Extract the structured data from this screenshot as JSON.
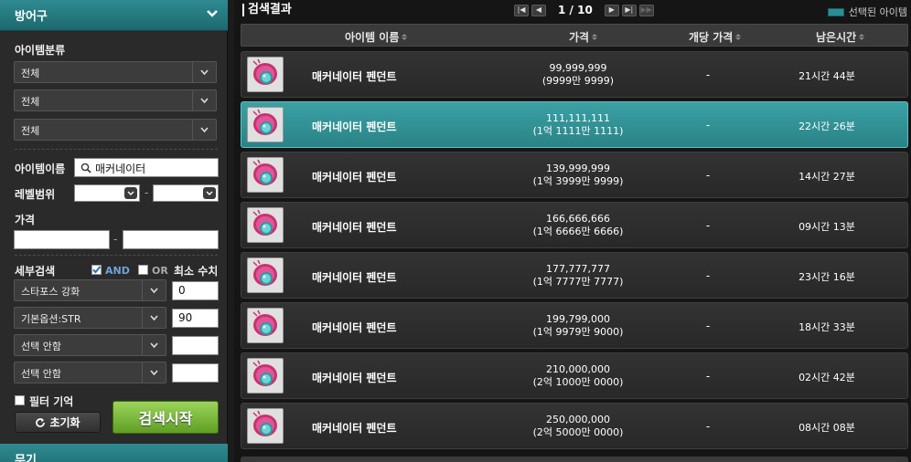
{
  "sidebar": {
    "category_title": "방어구",
    "next_category_title": "무기",
    "item_class_label": "아이템분류",
    "class_selects": [
      "전체",
      "전체",
      "전체"
    ],
    "item_name_label": "아이템이름",
    "item_name_value": "매커네이터",
    "level_range_label": "레벨범위",
    "level_dash": "-",
    "price_label": "가격",
    "price_dash": "-",
    "detail_label": "세부검색",
    "and_label": "AND",
    "or_label": "OR",
    "min_label": "최소 수치",
    "options": [
      {
        "name": "스타포스 강화",
        "value": "0"
      },
      {
        "name": "기본옵션:STR",
        "value": "90"
      },
      {
        "name": "선택 안함",
        "value": ""
      },
      {
        "name": "선택 안함",
        "value": ""
      }
    ],
    "filter_memory_label": "필터 기억",
    "reset_label": "초기화",
    "search_label": "검색시작"
  },
  "main": {
    "title": "검색결과",
    "page_info": "1 / 10",
    "legend_label": "선택된 아이템",
    "selected_color": "#2a8e92",
    "columns": [
      "아이템 이름",
      "가격",
      "개당 가격",
      "남은시간"
    ],
    "rows": [
      {
        "name": "매커네이터 펜던트",
        "price": "99,999,999",
        "price_kr": "(9999만 9999)",
        "unit": "-",
        "time": "21시간 44분"
      },
      {
        "name": "매커네이터 펜던트",
        "price": "111,111,111",
        "price_kr": "(1억 1111만 1111)",
        "unit": "-",
        "time": "22시간 26분"
      },
      {
        "name": "매커네이터 펜던트",
        "price": "139,999,999",
        "price_kr": "(1억 3999만 9999)",
        "unit": "-",
        "time": "14시간 27분"
      },
      {
        "name": "매커네이터 펜던트",
        "price": "166,666,666",
        "price_kr": "(1억 6666만 6666)",
        "unit": "-",
        "time": "09시간 13분"
      },
      {
        "name": "매커네이터 펜던트",
        "price": "177,777,777",
        "price_kr": "(1억 7777만 7777)",
        "unit": "-",
        "time": "23시간 16분"
      },
      {
        "name": "매커네이터 펜던트",
        "price": "199,799,000",
        "price_kr": "(1억 9979만 9000)",
        "unit": "-",
        "time": "18시간 33분"
      },
      {
        "name": "매커네이터 펜던트",
        "price": "210,000,000",
        "price_kr": "(2억 1000만 0000)",
        "unit": "-",
        "time": "02시간 42분"
      },
      {
        "name": "매커네이터 펜던트",
        "price": "250,000,000",
        "price_kr": "(2억 5000만 0000)",
        "unit": "-",
        "time": "08시간 08분"
      }
    ]
  }
}
